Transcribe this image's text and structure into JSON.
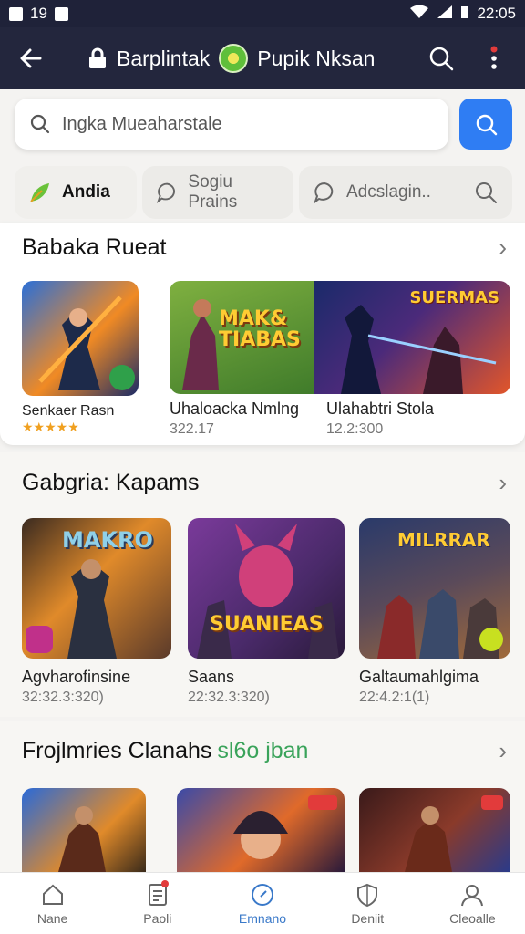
{
  "status": {
    "left_text": "19",
    "time": "22:05"
  },
  "appbar": {
    "title_left": "Barplintak",
    "title_right": "Pupik Nksan"
  },
  "search": {
    "placeholder": "Ingka Mueaharstale"
  },
  "chips": [
    {
      "label": "Andia",
      "icon": "leaf-icon"
    },
    {
      "label": "Sogiu Prains",
      "icon": "chat-icon"
    },
    {
      "label": "Adcslagin..",
      "icon": "chat-icon"
    }
  ],
  "sections": [
    {
      "title": "Babaka Rueat",
      "tiles": [
        {
          "name": "Senkaer Rasn",
          "rating": "★★★★★",
          "art_text": ""
        },
        {
          "name": "Uhaloacka Nmlng",
          "sub": "322.17",
          "art_text": "MAK& TIABAS"
        },
        {
          "name": "Ulahabtri Stola",
          "sub": "12.2:300",
          "art_text": "SUERMAS"
        }
      ]
    },
    {
      "title": "Gabgria: Kapams",
      "tiles": [
        {
          "name": "Agvharofinsine",
          "sub": "32:32.3:320)",
          "art_text": "MAKRO"
        },
        {
          "name": "Saans",
          "sub": "22:32.3:320)",
          "art_text": "SUANIEAS"
        },
        {
          "name": "Galtaumahlgima",
          "sub": "22:4.2:1(1)",
          "art_text": "MILRRAR"
        }
      ]
    },
    {
      "title_main": "Frojlmries Clanahs",
      "title_accent": "sl6o jban"
    }
  ],
  "bottom_nav": [
    {
      "label": "Nane",
      "icon": "home-icon"
    },
    {
      "label": "Paoli",
      "icon": "document-icon"
    },
    {
      "label": "Emnano",
      "icon": "compass-icon"
    },
    {
      "label": "Deniit",
      "icon": "shield-icon"
    },
    {
      "label": "Cleoalle",
      "icon": "person-icon"
    }
  ],
  "colors": {
    "appbar": "#23263d",
    "accent_blue": "#2f7df3",
    "accent_green": "#3aa35a"
  }
}
